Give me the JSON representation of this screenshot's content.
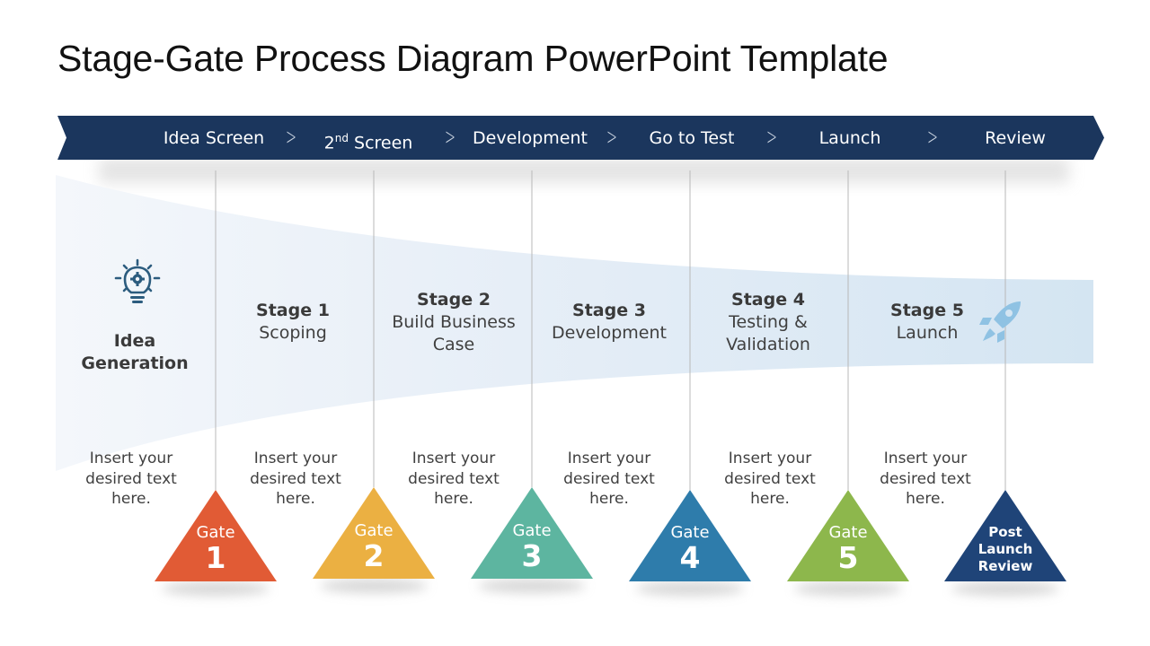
{
  "title": "Stage-Gate Process Diagram PowerPoint Template",
  "colors": {
    "banner": "#1b365d",
    "funnel_light": "#eef3f9",
    "funnel_dark": "#d4e5f2",
    "icon_dark": "#2c5c7e",
    "icon_light": "#8fc2e3"
  },
  "banner": {
    "items": [
      {
        "label": "Idea Screen"
      },
      {
        "label": "2",
        "sup": "nd",
        "rest": " Screen"
      },
      {
        "label": "Development"
      },
      {
        "label": "Go to Test"
      },
      {
        "label": "Launch"
      },
      {
        "label": "Review"
      }
    ],
    "separator_icon": "chevron-right-icon"
  },
  "idea": {
    "icon": "lightbulb-gear-icon",
    "line1": "Idea",
    "line2": "Generation"
  },
  "stages": [
    {
      "title": "Stage  1",
      "lines": [
        "Scoping"
      ]
    },
    {
      "title": "Stage  2",
      "lines": [
        "Build Business",
        "Case"
      ]
    },
    {
      "title": "Stage  3",
      "lines": [
        "Development"
      ]
    },
    {
      "title": "Stage  4",
      "lines": [
        "Testing &",
        "Validation"
      ]
    },
    {
      "title": "Stage  5",
      "lines": [
        "Launch"
      ],
      "icon": "rocket-icon"
    }
  ],
  "descriptions": [
    {
      "lines": [
        "Insert your",
        "desired text",
        "here."
      ]
    },
    {
      "lines": [
        "Insert your",
        "desired text",
        "here."
      ]
    },
    {
      "lines": [
        "Insert your",
        "desired text",
        "here."
      ]
    },
    {
      "lines": [
        "Insert your",
        "desired text",
        "here."
      ]
    },
    {
      "lines": [
        "Insert your",
        "desired text",
        "here."
      ]
    },
    {
      "lines": [
        "Insert your",
        "desired text",
        "here."
      ]
    }
  ],
  "gates": [
    {
      "word": "Gate",
      "number": "1",
      "color": "#e15b35"
    },
    {
      "word": "Gate",
      "number": "2",
      "color": "#ebb042"
    },
    {
      "word": "Gate",
      "number": "3",
      "color": "#5db5a0"
    },
    {
      "word": "Gate",
      "number": "4",
      "color": "#2e7cab"
    },
    {
      "word": "Gate",
      "number": "5",
      "color": "#8db74c"
    },
    {
      "lines": [
        "Post",
        "Launch",
        "Review"
      ],
      "color": "#1f4478"
    }
  ]
}
